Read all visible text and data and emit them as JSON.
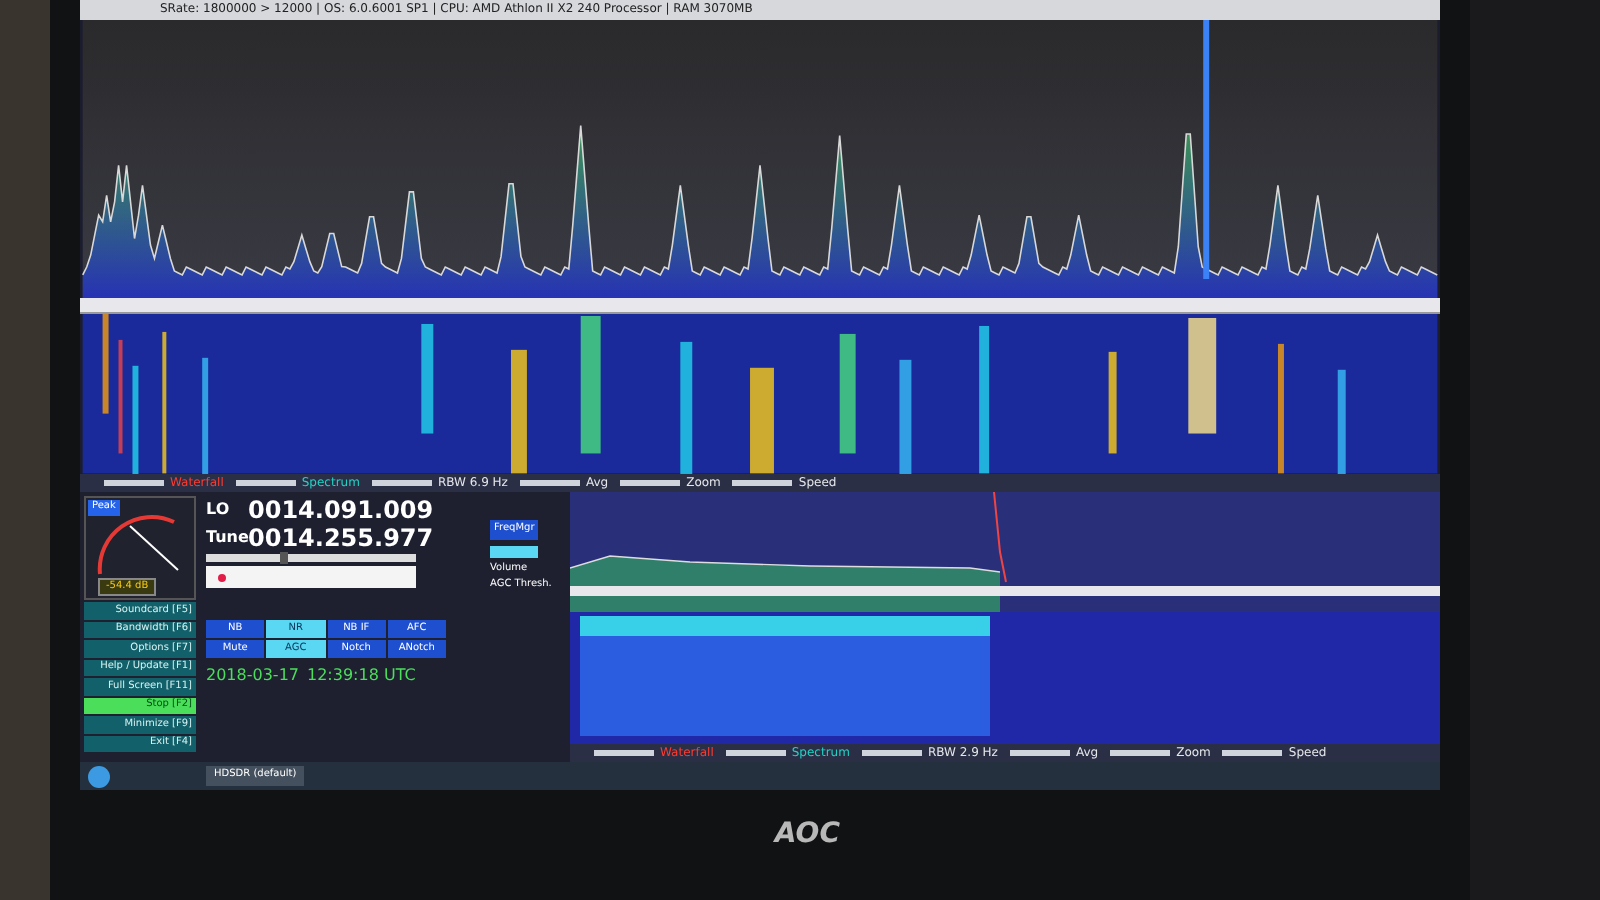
{
  "title_bar": {
    "text": "SRate: 1800000 > 12000 | OS: 6.0.6001 SP1 | CPU: AMD Athlon II X2 240 Processor | RAM 3070MB"
  },
  "rf_controls": [
    {
      "label": "Waterfall",
      "color": "#ff3b2f"
    },
    {
      "label": "Spectrum",
      "color": "#22d3c5"
    },
    {
      "label": "RBW 6.9 Hz",
      "color": "#e5e7eb"
    },
    {
      "label": "Avg",
      "color": "#e5e7eb"
    },
    {
      "label": "Zoom",
      "color": "#e5e7eb"
    },
    {
      "label": "Speed",
      "color": "#e5e7eb"
    }
  ],
  "smeter": {
    "label": "Peak",
    "reading": "-54.4 dB"
  },
  "frequencies": [
    {
      "label": "LO",
      "value": "0014.091.009"
    },
    {
      "label": "Tune",
      "value": "0014.255.977"
    }
  ],
  "tune_slider": {
    "level": 0.35
  },
  "freq_manager": {
    "label": "FreqMgr"
  },
  "volume_label": "Volume",
  "agc_label": "AGC Thresh.",
  "dsp_buttons": [
    {
      "label": "NB",
      "on": false
    },
    {
      "label": "NR",
      "on": true
    },
    {
      "label": "NB IF",
      "on": false
    },
    {
      "label": "AFC",
      "on": false
    },
    {
      "label": "Mute",
      "on": false
    },
    {
      "label": "AGC",
      "on": true
    },
    {
      "label": "Notch",
      "on": false
    },
    {
      "label": "ANotch",
      "on": false
    }
  ],
  "menu_buttons": [
    {
      "label": "Soundcard [F5]",
      "selected": false
    },
    {
      "label": "Bandwidth [F6]",
      "selected": false
    },
    {
      "label": "Options [F7]",
      "selected": false
    },
    {
      "label": "Help / Update [F1]",
      "selected": false
    },
    {
      "label": "Full Screen [F11]",
      "selected": false
    },
    {
      "label": "Stop [F2]",
      "selected": true
    },
    {
      "label": "Minimize [F9]",
      "selected": false
    },
    {
      "label": "Exit [F4]",
      "selected": false
    }
  ],
  "clock": {
    "date": "2018-03-17",
    "time": "12:39:18 UTC"
  },
  "af_controls": [
    {
      "label": "Waterfall",
      "color": "#ff3b2f"
    },
    {
      "label": "Spectrum",
      "color": "#22d3c5"
    },
    {
      "label": "RBW 2.9 Hz",
      "color": "#e5e7eb"
    },
    {
      "label": "Avg",
      "color": "#e5e7eb"
    },
    {
      "label": "Zoom",
      "color": "#e5e7eb"
    },
    {
      "label": "Speed",
      "color": "#e5e7eb"
    }
  ],
  "taskbar": {
    "task": "HDSDR (default)"
  },
  "monitor": {
    "brand": "AOC"
  }
}
